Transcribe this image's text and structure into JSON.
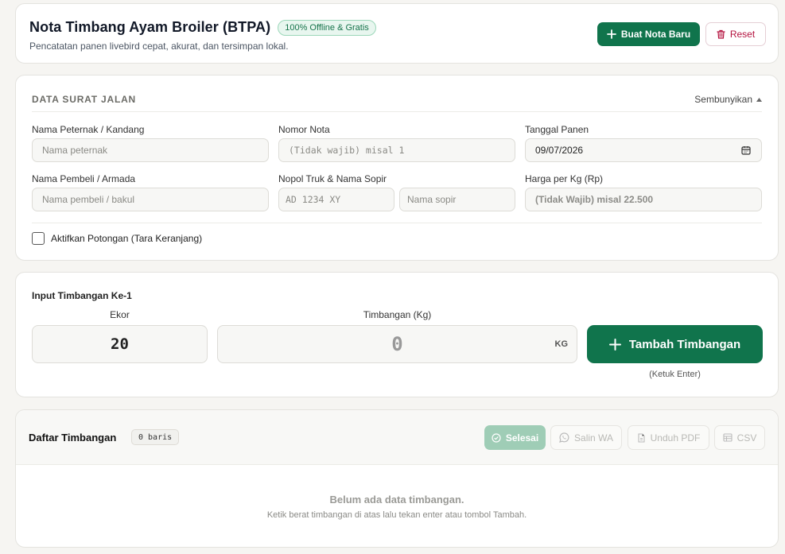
{
  "header": {
    "title": "Nota Timbang Ayam Broiler (BTPA)",
    "badge": "100% Offline & Gratis",
    "subtitle": "Pencatatan panen livebird cepat, akurat, dan tersimpan lokal.",
    "new_button": "Buat Nota Baru",
    "reset_button": "Reset"
  },
  "surat_jalan": {
    "title": "DATA SURAT JALAN",
    "toggle": "Sembunyikan",
    "fields": {
      "peternak": {
        "label": "Nama Peternak / Kandang",
        "placeholder": "Nama peternak"
      },
      "nota": {
        "label": "Nomor Nota",
        "placeholder": "(Tidak wajib) misal 1"
      },
      "tanggal": {
        "label": "Tanggal Panen",
        "value": "09/07/2026"
      },
      "pembeli": {
        "label": "Nama Pembeli / Armada",
        "placeholder": "Nama pembeli / bakul"
      },
      "nopol": {
        "label": "Nopol Truk & Nama Sopir",
        "placeholder": "AD 1234 XY"
      },
      "sopir": {
        "placeholder": "Nama sopir"
      },
      "harga": {
        "label": "Harga per Kg (Rp)",
        "placeholder": "(Tidak Wajib) misal 22.500"
      }
    },
    "potongan_label": "Aktifkan Potongan (Tara Keranjang)"
  },
  "input_timbangan": {
    "title": "Input Timbangan Ke-1",
    "ekor_label": "Ekor",
    "ekor_value": "20",
    "kg_label": "Timbangan (Kg)",
    "kg_value": "0",
    "kg_unit": "KG",
    "add_button": "Tambah Timbangan",
    "hint": "(Ketuk Enter)"
  },
  "daftar": {
    "title": "Daftar Timbangan",
    "rows_badge": "0 baris",
    "buttons": {
      "selesai": "Selesai",
      "salin_wa": "Salin WA",
      "unduh_pdf": "Unduh PDF",
      "csv": "CSV"
    },
    "empty_title": "Belum ada data timbangan.",
    "empty_subtitle": "Ketik berat timbangan di atas lalu tekan enter atau tombol Tambah."
  },
  "colors": {
    "primary": "#10744c",
    "danger": "#b4123e",
    "badge_bg": "#e8f6ef"
  }
}
